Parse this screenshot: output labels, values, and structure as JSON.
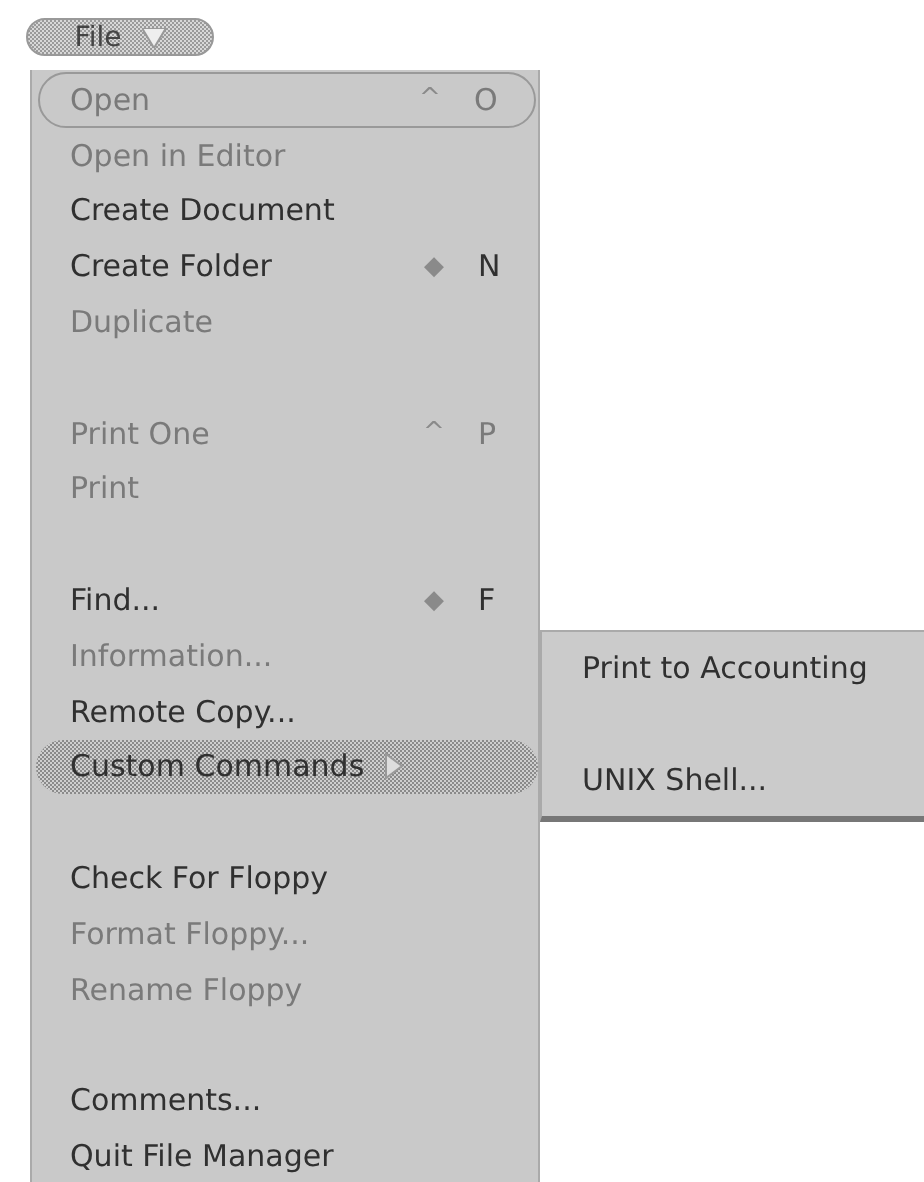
{
  "menu_button": {
    "label": "File"
  },
  "menu": {
    "groups": [
      [
        {
          "label": "Open",
          "disabled": true,
          "focused": true,
          "selected": false,
          "shortcut": {
            "modifier": "^",
            "key": "O"
          }
        },
        {
          "label": "Open in Editor",
          "disabled": true,
          "focused": false,
          "selected": false
        },
        {
          "label": "Create Document",
          "disabled": false,
          "focused": false,
          "selected": false
        },
        {
          "label": "Create Folder",
          "disabled": false,
          "focused": false,
          "selected": false,
          "shortcut": {
            "modifier": "◆",
            "key": "N"
          }
        },
        {
          "label": "Duplicate",
          "disabled": true,
          "focused": false,
          "selected": false
        }
      ],
      [
        {
          "label": "Print One",
          "disabled": true,
          "focused": false,
          "selected": false,
          "shortcut": {
            "modifier": "^",
            "key": "P"
          }
        },
        {
          "label": "Print",
          "disabled": true,
          "focused": false,
          "selected": false
        }
      ],
      [
        {
          "label": "Find...",
          "disabled": false,
          "focused": false,
          "selected": false,
          "shortcut": {
            "modifier": "◆",
            "key": "F"
          }
        },
        {
          "label": "Information...",
          "disabled": true,
          "focused": false,
          "selected": false
        },
        {
          "label": "Remote Copy...",
          "disabled": false,
          "focused": false,
          "selected": false
        },
        {
          "label": "Custom Commands",
          "disabled": false,
          "focused": false,
          "selected": true,
          "submenu": {
            "groups": [
              [
                {
                  "label": "Print to Accounting",
                  "disabled": false
                }
              ],
              [
                {
                  "label": "UNIX Shell...",
                  "disabled": false
                }
              ]
            ]
          }
        }
      ],
      [
        {
          "label": "Check For Floppy",
          "disabled": false,
          "focused": false,
          "selected": false
        },
        {
          "label": "Format Floppy...",
          "disabled": true,
          "focused": false,
          "selected": false
        },
        {
          "label": "Rename Floppy",
          "disabled": true,
          "focused": false,
          "selected": false
        }
      ],
      [
        {
          "label": "Comments...",
          "disabled": false,
          "focused": false,
          "selected": false
        },
        {
          "label": "Quit File Manager",
          "disabled": false,
          "focused": false,
          "selected": false
        }
      ]
    ]
  }
}
